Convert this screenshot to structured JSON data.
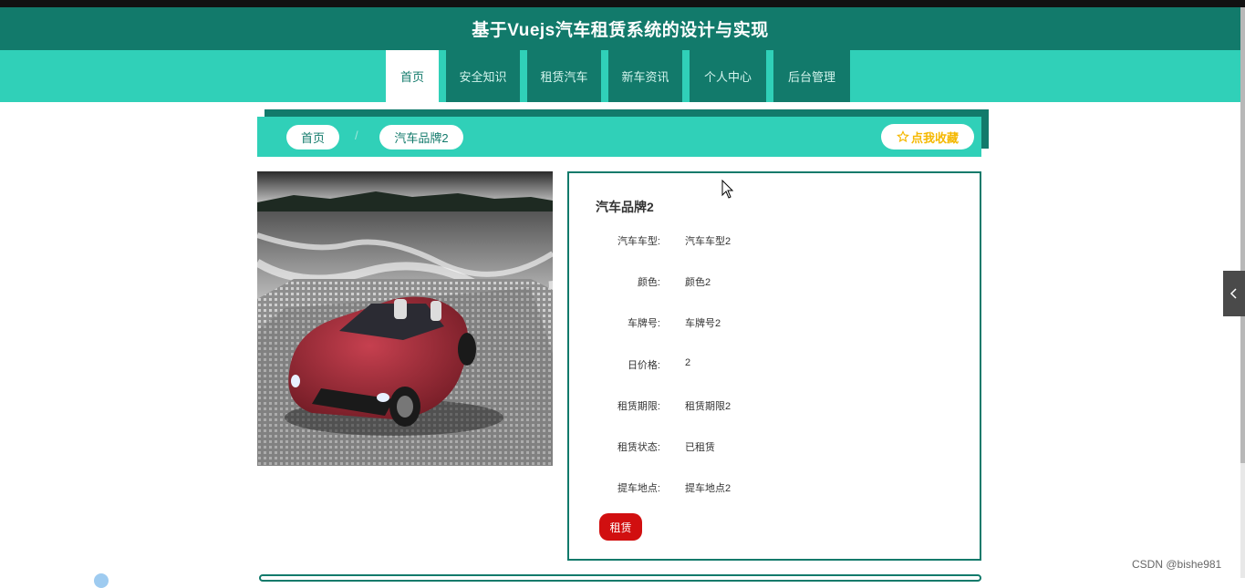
{
  "header": {
    "title": "基于Vuejs汽车租赁系统的设计与实现"
  },
  "nav": {
    "items": [
      {
        "label": "首页"
      },
      {
        "label": "安全知识"
      },
      {
        "label": "租赁汽车"
      },
      {
        "label": "新车资讯"
      },
      {
        "label": "个人中心"
      },
      {
        "label": "后台管理"
      }
    ],
    "active_index": 0
  },
  "breadcrumb": {
    "home": "首页",
    "current": "汽车品牌2",
    "separator": "/"
  },
  "favorite": {
    "icon": "star-icon",
    "label": "点我收藏"
  },
  "car": {
    "name": "汽车品牌2",
    "fields": [
      {
        "label": "汽车车型:",
        "value": "汽车车型2"
      },
      {
        "label": "颜色:",
        "value": "颜色2"
      },
      {
        "label": "车牌号:",
        "value": "车牌号2"
      },
      {
        "label": "日价格:",
        "value": "2"
      },
      {
        "label": "租赁期限:",
        "value": "租赁期限2"
      },
      {
        "label": "租赁状态:",
        "value": "已租赁"
      },
      {
        "label": "提车地点:",
        "value": "提车地点2"
      }
    ],
    "rent_label": "租赁"
  },
  "side_tab": {
    "icon": "chevron-left-icon"
  },
  "watermark": "CSDN @bishe981",
  "colors": {
    "primary_dark": "#127a6b",
    "primary_light": "#30d0b8",
    "rent_button": "#d10f10",
    "favorite_text": "#f5b800"
  }
}
